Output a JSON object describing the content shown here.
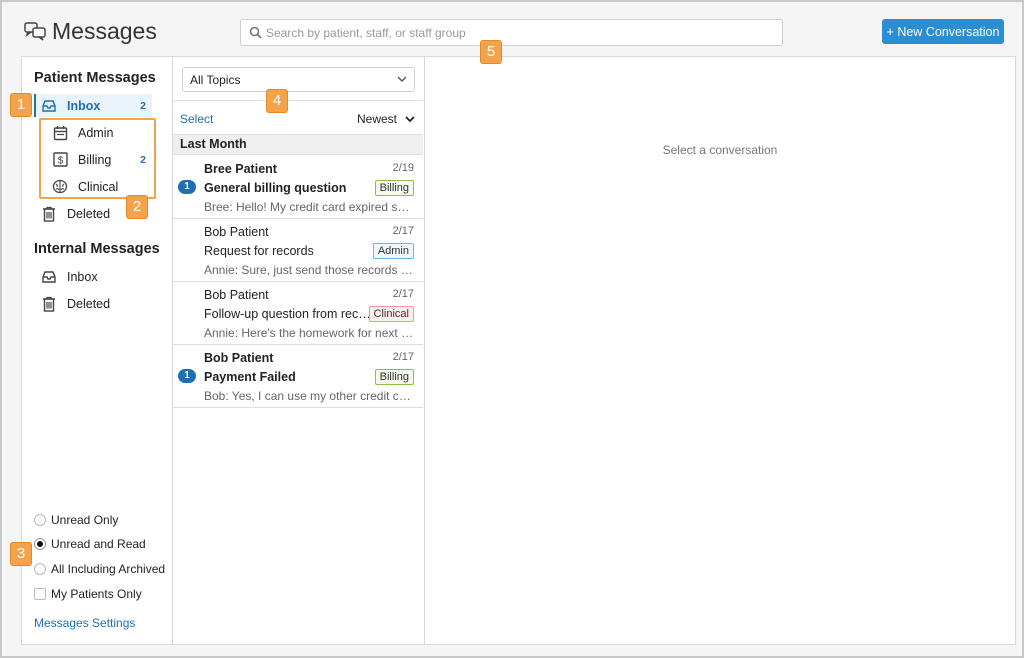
{
  "header": {
    "title": "Messages",
    "search_placeholder": "Search by patient, staff, or staff group",
    "new_conversation_label": "+ New Conversation"
  },
  "sidebar": {
    "patient_section_title": "Patient Messages",
    "patient_items": [
      {
        "label": "Inbox",
        "count": "2",
        "icon": "inbox-icon"
      },
      {
        "label": "Admin",
        "count": "",
        "icon": "calendar-icon"
      },
      {
        "label": "Billing",
        "count": "2",
        "icon": "dollar-icon"
      },
      {
        "label": "Clinical",
        "count": "",
        "icon": "brain-icon"
      },
      {
        "label": "Deleted",
        "count": "",
        "icon": "trash-icon"
      }
    ],
    "internal_section_title": "Internal Messages",
    "internal_items": [
      {
        "label": "Inbox",
        "icon": "inbox-icon"
      },
      {
        "label": "Deleted",
        "icon": "trash-icon"
      }
    ],
    "filters": [
      {
        "label": "Unread Only",
        "type": "radio",
        "checked": false
      },
      {
        "label": "Unread and Read",
        "type": "radio",
        "checked": true
      },
      {
        "label": "All Including Archived",
        "type": "radio",
        "checked": false
      },
      {
        "label": "My Patients Only",
        "type": "checkbox",
        "checked": false
      }
    ],
    "settings_link": "Messages Settings"
  },
  "list": {
    "topic_filter": "All Topics",
    "select_label": "Select",
    "sort_label": "Newest",
    "group_label": "Last Month",
    "messages": [
      {
        "sender": "Bree Patient",
        "date": "2/19",
        "subject": "General billing question",
        "preview": "Bree: Hello! My credit card expired so I'd like to update it",
        "tag": "Billing",
        "unread": true,
        "unread_count": "1"
      },
      {
        "sender": "Bob Patient",
        "date": "2/17",
        "subject": "Request for records",
        "preview": "Annie: Sure, just send those records over when you can",
        "tag": "Admin",
        "unread": false,
        "unread_count": ""
      },
      {
        "sender": "Bob Patient",
        "date": "2/17",
        "subject": "Follow-up question from recent session",
        "preview": "Annie: Here's the homework for next week",
        "tag": "Clinical",
        "unread": false,
        "unread_count": ""
      },
      {
        "sender": "Bob Patient",
        "date": "2/17",
        "subject": "Payment Failed",
        "preview": "Bob: Yes, I can use my other credit card instead",
        "tag": "Billing",
        "unread": true,
        "unread_count": "1"
      }
    ]
  },
  "detail": {
    "empty_text": "Select a conversation"
  },
  "callouts": [
    "1",
    "2",
    "3",
    "4",
    "5"
  ],
  "colors": {
    "accent": "#2a8ed3",
    "link": "#1f6fae",
    "callout": "#f5a34a"
  }
}
